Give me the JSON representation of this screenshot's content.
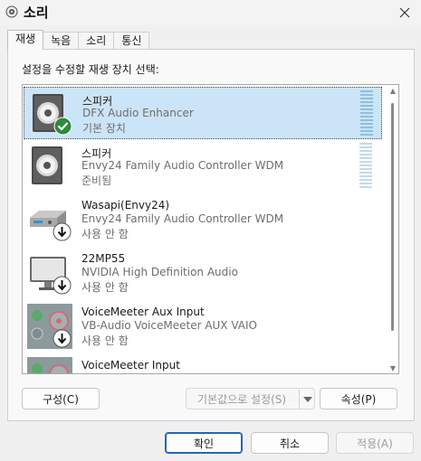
{
  "window": {
    "title": "소리"
  },
  "tabs": [
    {
      "label": "재생"
    },
    {
      "label": "녹음"
    },
    {
      "label": "소리"
    },
    {
      "label": "통신"
    }
  ],
  "instruction": "설정을 수정할 재생 장치 선택:",
  "devices": [
    {
      "name": "스피커",
      "description": "DFX Audio Enhancer",
      "status": "기본 장치",
      "icon": "speaker-icon",
      "badge": "default-check-icon"
    },
    {
      "name": "스피커",
      "description": "Envy24 Family Audio Controller WDM",
      "status": "준비됨",
      "icon": "speaker-icon",
      "badge": ""
    },
    {
      "name": "Wasapi(Envy24)",
      "description": "Envy24 Family Audio Controller WDM",
      "status": "사용 안 함",
      "icon": "receiver-icon",
      "badge": "disabled-arrow-icon"
    },
    {
      "name": "22MP55",
      "description": "NVIDIA High Definition Audio",
      "status": "사용 안 함",
      "icon": "monitor-icon",
      "badge": "disabled-arrow-icon"
    },
    {
      "name": "VoiceMeeter Aux Input",
      "description": "VB-Audio VoiceMeeter AUX VAIO",
      "status": "사용 안 함",
      "icon": "voicemeeter-icon",
      "badge": "disabled-arrow-icon"
    },
    {
      "name": "VoiceMeeter Input",
      "description": "",
      "status": "",
      "icon": "voicemeeter-icon",
      "badge": ""
    }
  ],
  "buttons": {
    "configure": "구성(C)",
    "set_default": "기본값으로 설정(S)",
    "properties": "속성(P)",
    "ok": "확인",
    "cancel": "취소",
    "apply": "적용(A)"
  },
  "colors": {
    "selected_row": "#cce4f7",
    "default_badge": "#2e8b3e",
    "primary_border": "#2a63b5"
  }
}
